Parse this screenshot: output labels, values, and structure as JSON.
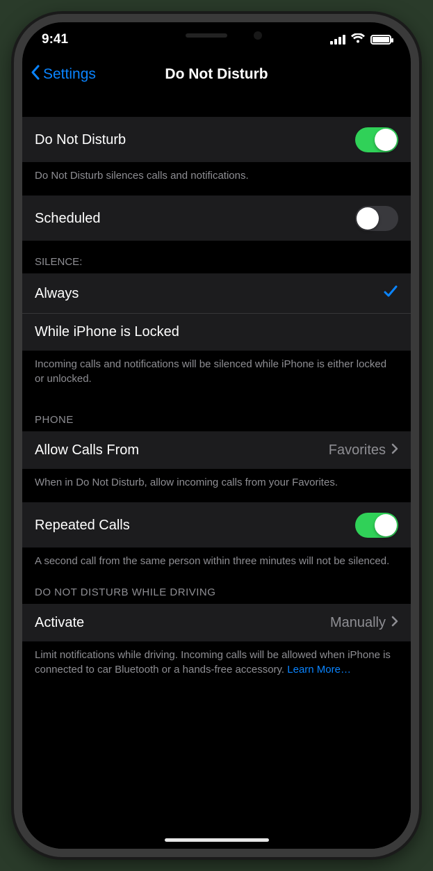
{
  "statusbar": {
    "time": "9:41"
  },
  "nav": {
    "back": "Settings",
    "title": "Do Not Disturb"
  },
  "group1": {
    "dnd_label": "Do Not Disturb",
    "dnd_on": true,
    "footer": "Do Not Disturb silences calls and notifications."
  },
  "group2": {
    "scheduled_label": "Scheduled",
    "scheduled_on": false
  },
  "silence": {
    "header": "SILENCE:",
    "always": "Always",
    "locked": "While iPhone is Locked",
    "selected": "always",
    "footer": "Incoming calls and notifications will be silenced while iPhone is either locked or unlocked."
  },
  "phone": {
    "header": "PHONE",
    "allow_label": "Allow Calls From",
    "allow_value": "Favorites",
    "allow_footer": "When in Do Not Disturb, allow incoming calls from your Favorites.",
    "repeated_label": "Repeated Calls",
    "repeated_on": true,
    "repeated_footer": "A second call from the same person within three minutes will not be silenced."
  },
  "driving": {
    "header": "DO NOT DISTURB WHILE DRIVING",
    "activate_label": "Activate",
    "activate_value": "Manually",
    "footer_text": "Limit notifications while driving. Incoming calls will be allowed when iPhone is connected to car Bluetooth or a hands-free accessory. ",
    "learn_more": "Learn More…"
  }
}
